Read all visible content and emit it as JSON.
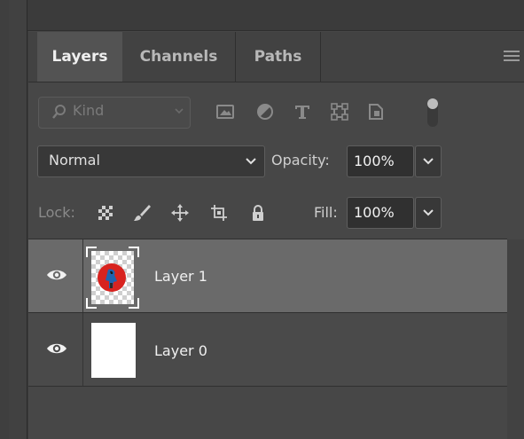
{
  "tabs": [
    {
      "label": "Layers",
      "active": true
    },
    {
      "label": "Channels",
      "active": false
    },
    {
      "label": "Paths",
      "active": false
    }
  ],
  "filter": {
    "kind_label": "Kind",
    "icons": [
      "image-filter-icon",
      "adjustment-filter-icon",
      "type-filter-icon",
      "shape-filter-icon",
      "smart-object-filter-icon",
      "filter-toggle-icon"
    ]
  },
  "blend": {
    "mode": "Normal",
    "opacity_label": "Opacity:",
    "opacity_value": "100%"
  },
  "lock": {
    "label": "Lock:",
    "icons": [
      "lock-transparent-pixels-icon",
      "lock-image-pixels-icon",
      "lock-position-icon",
      "lock-artboard-icon",
      "lock-all-icon"
    ],
    "fill_label": "Fill:",
    "fill_value": "100%"
  },
  "layers": [
    {
      "name": "Layer 1",
      "selected": true,
      "visible": true
    },
    {
      "name": "Layer 0",
      "selected": false,
      "visible": true
    }
  ],
  "colors": {
    "panel_bg": "#474747",
    "selected_row": "#6a6a6a",
    "thumb_art_red": "#d8231f",
    "thumb_art_blue": "#1f63b0"
  }
}
